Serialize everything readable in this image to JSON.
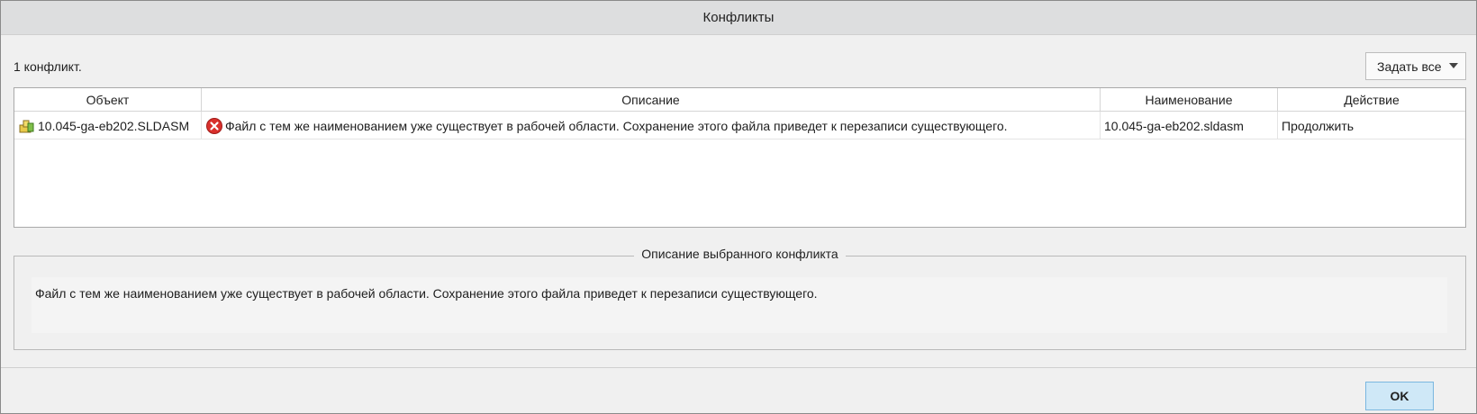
{
  "window": {
    "title": "Конфликты"
  },
  "summary": {
    "count_text": "1 конфликт."
  },
  "toolbar": {
    "set_all_label": "Задать все"
  },
  "table": {
    "columns": [
      "Объект",
      "Описание",
      "Наименование",
      "Действие"
    ],
    "rows": [
      {
        "object": "10.045-ga-eb202.SLDASM",
        "object_icon": "assembly-icon",
        "status_icon": "error-icon",
        "description": "Файл с тем же наименованием уже существует в рабочей области. Сохранение этого файла приведет к перезаписи существующего.",
        "name": "10.045-ga-eb202.sldasm",
        "action": "Продолжить"
      }
    ]
  },
  "details": {
    "legend": "Описание выбранного конфликта",
    "text": "Файл с тем же наименованием уже существует в рабочей области. Сохранение этого файла приведет к перезаписи существующего."
  },
  "footer": {
    "ok_label": "OK"
  },
  "colors": {
    "ok_button_bg": "#cfe8f7",
    "ok_button_border": "#7ab7e0",
    "error_icon": "#d9302c"
  }
}
